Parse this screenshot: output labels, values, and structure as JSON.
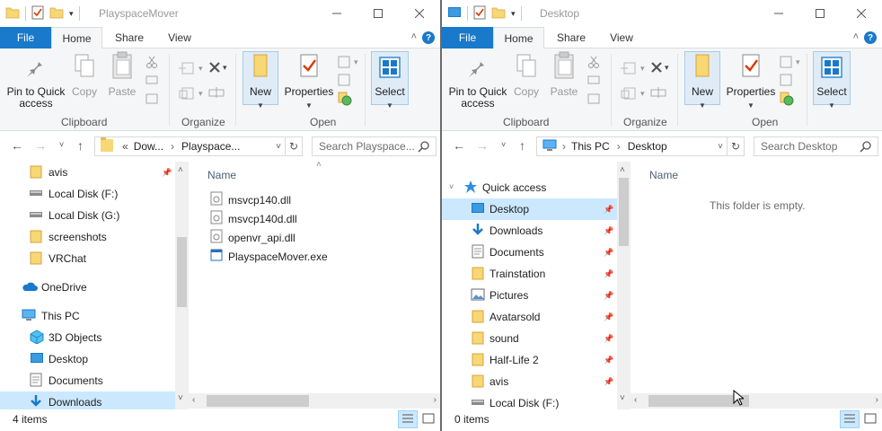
{
  "left_window": {
    "title": "PlayspaceMover",
    "tabs": {
      "file": "File",
      "home": "Home",
      "share": "Share",
      "view": "View"
    },
    "ribbon": {
      "pin_to_quick_access": "Pin to Quick access",
      "copy": "Copy",
      "paste": "Paste",
      "new": "New",
      "properties": "Properties",
      "select": "Select",
      "groups": {
        "clipboard": "Clipboard",
        "organize": "Organize",
        "open": "Open"
      }
    },
    "address": {
      "overflow": "«",
      "segments": [
        "Dow...",
        "Playspace..."
      ]
    },
    "search_placeholder": "Search Playspace...",
    "nav_items": [
      {
        "label": "avis",
        "icon": "folder-icon",
        "pinned": true
      },
      {
        "label": "Local Disk (F:)",
        "icon": "drive-icon"
      },
      {
        "label": "Local Disk (G:)",
        "icon": "drive-icon"
      },
      {
        "label": "screenshots",
        "icon": "folder-icon"
      },
      {
        "label": "VRChat",
        "icon": "folder-icon"
      },
      {
        "label": "OneDrive",
        "icon": "cloud-icon"
      },
      {
        "label": "This PC",
        "icon": "pc-icon"
      },
      {
        "label": "3D Objects",
        "icon": "cube-icon"
      },
      {
        "label": "Desktop",
        "icon": "desktop-icon"
      },
      {
        "label": "Documents",
        "icon": "documents-icon"
      },
      {
        "label": "Downloads",
        "icon": "download-icon",
        "selected": true
      }
    ],
    "column_header": "Name",
    "files": [
      {
        "name": "msvcp140.dll",
        "icon": "dll-icon"
      },
      {
        "name": "msvcp140d.dll",
        "icon": "dll-icon"
      },
      {
        "name": "openvr_api.dll",
        "icon": "dll-icon"
      },
      {
        "name": "PlayspaceMover.exe",
        "icon": "exe-icon"
      }
    ],
    "status": "4 items"
  },
  "right_window": {
    "title": "Desktop",
    "tabs": {
      "file": "File",
      "home": "Home",
      "share": "Share",
      "view": "View"
    },
    "ribbon": {
      "pin_to_quick_access": "Pin to Quick access",
      "copy": "Copy",
      "paste": "Paste",
      "new": "New",
      "properties": "Properties",
      "select": "Select",
      "groups": {
        "clipboard": "Clipboard",
        "organize": "Organize",
        "open": "Open"
      }
    },
    "address": {
      "segments": [
        "This PC",
        "Desktop"
      ]
    },
    "search_placeholder": "Search Desktop",
    "nav_items": [
      {
        "label": "Quick access",
        "icon": "star-icon"
      },
      {
        "label": "Desktop",
        "icon": "desktop-icon",
        "pinned": true,
        "selected": true
      },
      {
        "label": "Downloads",
        "icon": "download-icon",
        "pinned": true
      },
      {
        "label": "Documents",
        "icon": "documents-icon",
        "pinned": true
      },
      {
        "label": "Trainstation",
        "icon": "folder-icon",
        "pinned": true
      },
      {
        "label": "Pictures",
        "icon": "pictures-icon",
        "pinned": true
      },
      {
        "label": "Avatarsold",
        "icon": "folder-icon",
        "pinned": true
      },
      {
        "label": "sound",
        "icon": "folder-icon",
        "pinned": true
      },
      {
        "label": "Half-Life 2",
        "icon": "folder-icon",
        "pinned": true
      },
      {
        "label": "avis",
        "icon": "folder-icon",
        "pinned": true
      },
      {
        "label": "Local Disk (F:)",
        "icon": "drive-icon"
      }
    ],
    "column_header": "Name",
    "empty_message": "This folder is empty.",
    "status": "0 items"
  }
}
